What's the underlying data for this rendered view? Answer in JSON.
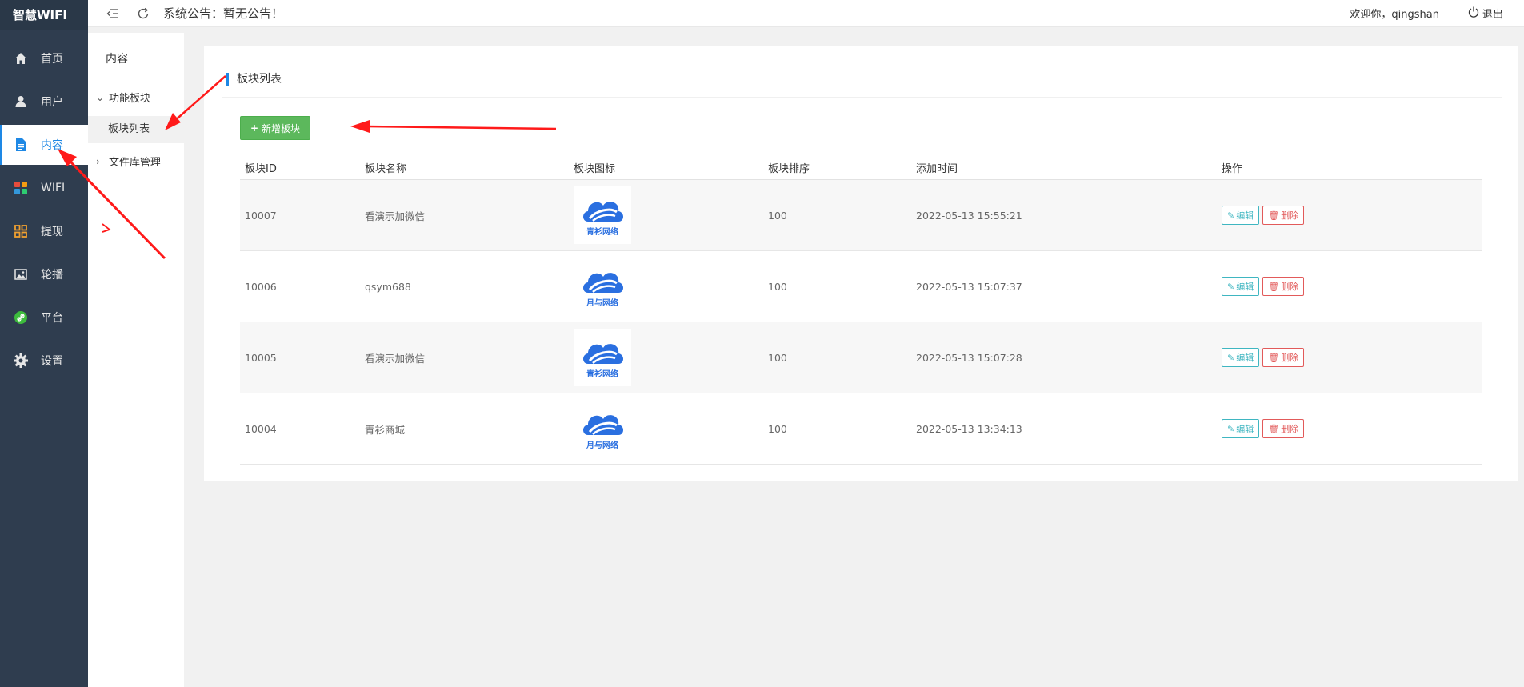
{
  "app": {
    "title": "智慧WIFI"
  },
  "sidebar": {
    "items": [
      {
        "label": "首页",
        "icon": "home-icon"
      },
      {
        "label": "用户",
        "icon": "user-icon"
      },
      {
        "label": "内容",
        "icon": "document-icon",
        "active": true
      },
      {
        "label": "WIFI",
        "icon": "wifi-apps-icon"
      },
      {
        "label": "提现",
        "icon": "grid-icon"
      },
      {
        "label": "轮播",
        "icon": "image-icon"
      },
      {
        "label": "平台",
        "icon": "link-icon"
      },
      {
        "label": "设置",
        "icon": "gear-icon"
      }
    ]
  },
  "subnav": {
    "title": "内容",
    "groups": [
      {
        "label": "功能板块",
        "expanded": true,
        "items": [
          {
            "label": "板块列表",
            "active": true
          }
        ]
      },
      {
        "label": "文件库管理",
        "expanded": false
      }
    ]
  },
  "header": {
    "notice": "系统公告：暂无公告！",
    "welcome": "欢迎你，qingshan",
    "logout": "退出"
  },
  "panel": {
    "title": "板块列表",
    "add_button": "新增板块",
    "columns": [
      "板块ID",
      "板块名称",
      "板块图标",
      "板块排序",
      "添加时间",
      "操作"
    ],
    "rows": [
      {
        "id": "10007",
        "name": "看演示加微信",
        "icon_text": "青衫网络",
        "sort": "100",
        "time": "2022-05-13 15:55:21"
      },
      {
        "id": "10006",
        "name": "qsym688",
        "icon_text": "月与网络",
        "sort": "100",
        "time": "2022-05-13 15:07:37"
      },
      {
        "id": "10005",
        "name": "看演示加微信",
        "icon_text": "青衫网络",
        "sort": "100",
        "time": "2022-05-13 15:07:28"
      },
      {
        "id": "10004",
        "name": "青衫商城",
        "icon_text": "月与网络",
        "sort": "100",
        "time": "2022-05-13 13:34:13"
      }
    ],
    "edit_label": "编辑",
    "delete_label": "删除"
  },
  "colors": {
    "sidebar_bg": "#2f3d4f",
    "accent": "#1e88e5",
    "add_button": "#5cb85c",
    "edit": "#3fb6c1",
    "delete": "#e25a5a",
    "annotation_arrow": "#ff1a1a"
  }
}
